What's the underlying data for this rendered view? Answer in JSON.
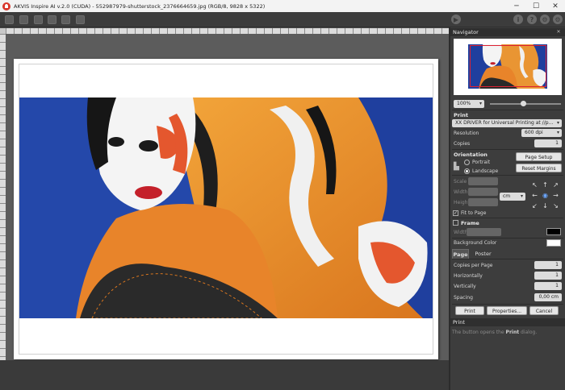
{
  "window": {
    "title": "AKVIS Inspire AI v.2.0 (CUDA) - 552987979-shutterstock_2376664659.jpg (RGB/8, 9828 x 5322)"
  },
  "navigator": {
    "title": "Navigator",
    "zoom": "100%"
  },
  "print": {
    "title": "Print",
    "printer": "XX DRIVER for Universal Printing at //p...",
    "resolution_label": "Resolution",
    "resolution_value": "600 dpi",
    "copies_label": "Copies",
    "copies_value": "1"
  },
  "orientation": {
    "title": "Orientation",
    "portrait": "Portrait",
    "landscape": "Landscape",
    "page_setup": "Page Setup",
    "reset_margins": "Reset Margins",
    "selected": "landscape"
  },
  "size": {
    "scale_label": "Scale",
    "width_label": "Width",
    "height_label": "Height",
    "unit": "cm",
    "fit_to_page": "Fit to Page",
    "fit_to_page_checked": true
  },
  "frame": {
    "label": "Frame",
    "checked": false,
    "width_label": "Width",
    "color": "#000000"
  },
  "background": {
    "label": "Background Color",
    "color": "#ffffff"
  },
  "tabs": [
    {
      "label": "Page",
      "active": true
    },
    {
      "label": "Poster",
      "active": false
    }
  ],
  "poster": {
    "copies_per_page_label": "Copies per Page",
    "copies_per_page": "1",
    "horizontally_label": "Horizontally",
    "horizontally": "1",
    "vertically_label": "Vertically",
    "vertically": "1",
    "spacing_label": "Spacing",
    "spacing": "0,00 cm"
  },
  "actions": {
    "print": "Print",
    "properties": "Properties...",
    "cancel": "Cancel"
  },
  "help": {
    "title": "Print",
    "text_before": "The button opens the",
    "bold": "Print",
    "text_after": "dialog."
  }
}
